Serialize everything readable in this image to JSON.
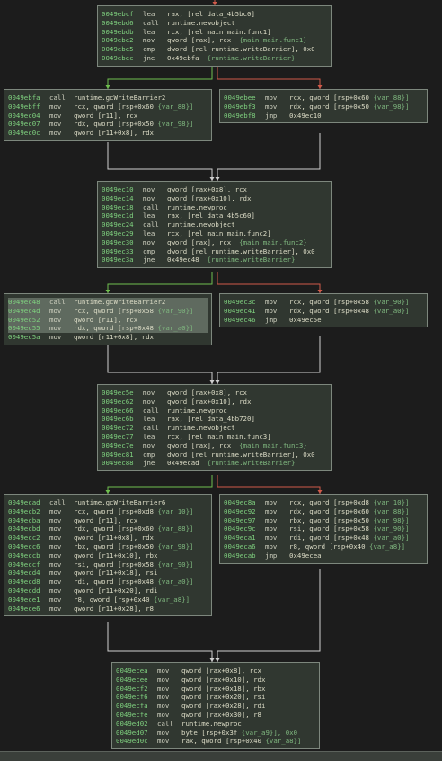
{
  "colors": {
    "background": "#1c1c1c",
    "block_fill": "#303730",
    "block_border": "#7d877d",
    "address": "#7fd17f",
    "mnemonic": "#cfd1c0",
    "operand": "#dcdcc6",
    "comment": "#7fb77f",
    "edge_unconditional": "#cfcfcf",
    "edge_true": "#6fbf4f",
    "edge_false": "#d05a4a",
    "highlight": "#5f6a5f"
  },
  "blocks": [
    {
      "id": "b0",
      "lines": [
        {
          "addr": "0049ebcf",
          "mn": "lea",
          "op": "rax, [rel data_4b5bc0]",
          "cm": ""
        },
        {
          "addr": "0049ebd6",
          "mn": "call",
          "op": "runtime.newobject",
          "cm": ""
        },
        {
          "addr": "0049ebdb",
          "mn": "lea",
          "op": "rcx, [rel main.main.func1]",
          "cm": ""
        },
        {
          "addr": "0049ebe2",
          "mn": "mov",
          "op": "qword [rax], rcx",
          "cm": "  {main.main.func1}"
        },
        {
          "addr": "0049ebe5",
          "mn": "cmp",
          "op": "dword [rel runtime.writeBarrier], 0x0",
          "cm": ""
        },
        {
          "addr": "0049ebec",
          "mn": "jne",
          "op": "0x49ebfa",
          "cm": "  {runtime.writeBarrier}"
        }
      ]
    },
    {
      "id": "b1",
      "lines": [
        {
          "addr": "0049ebfa",
          "mn": "call",
          "op": "runtime.gcWriteBarrier2",
          "cm": ""
        },
        {
          "addr": "0049ebff",
          "mn": "mov",
          "op": "rcx, qword [rsp+0x60 ",
          "cm": "{var_88}]"
        },
        {
          "addr": "0049ec04",
          "mn": "mov",
          "op": "qword [r11], rcx",
          "cm": ""
        },
        {
          "addr": "0049ec07",
          "mn": "mov",
          "op": "rdx, qword [rsp+0x50 ",
          "cm": "{var_98}]"
        },
        {
          "addr": "0049ec0c",
          "mn": "mov",
          "op": "qword [r11+0x8], rdx",
          "cm": ""
        }
      ]
    },
    {
      "id": "b2",
      "lines": [
        {
          "addr": "0049ebee",
          "mn": "mov",
          "op": "rcx, qword [rsp+0x60 ",
          "cm": "{var_88}]"
        },
        {
          "addr": "0049ebf3",
          "mn": "mov",
          "op": "rdx, qword [rsp+0x50 ",
          "cm": "{var_98}]"
        },
        {
          "addr": "0049ebf8",
          "mn": "jmp",
          "op": "0x49ec10",
          "cm": ""
        }
      ]
    },
    {
      "id": "b3",
      "lines": [
        {
          "addr": "0049ec10",
          "mn": "mov",
          "op": "qword [rax+0x8], rcx",
          "cm": ""
        },
        {
          "addr": "0049ec14",
          "mn": "mov",
          "op": "qword [rax+0x10], rdx",
          "cm": ""
        },
        {
          "addr": "0049ec18",
          "mn": "call",
          "op": "runtime.newproc",
          "cm": ""
        },
        {
          "addr": "0049ec1d",
          "mn": "lea",
          "op": "rax, [rel data_4b5c60]",
          "cm": ""
        },
        {
          "addr": "0049ec24",
          "mn": "call",
          "op": "runtime.newobject",
          "cm": ""
        },
        {
          "addr": "0049ec29",
          "mn": "lea",
          "op": "rcx, [rel main.main.func2]",
          "cm": ""
        },
        {
          "addr": "0049ec30",
          "mn": "mov",
          "op": "qword [rax], rcx",
          "cm": "  {main.main.func2}"
        },
        {
          "addr": "0049ec33",
          "mn": "cmp",
          "op": "dword [rel runtime.writeBarrier], 0x0",
          "cm": ""
        },
        {
          "addr": "0049ec3a",
          "mn": "jne",
          "op": "0x49ec48",
          "cm": "  {runtime.writeBarrier}"
        }
      ]
    },
    {
      "id": "b4",
      "lines": [
        {
          "addr": "0049ec48",
          "mn": "call",
          "op": "runtime.gcWriteBarrier2",
          "cm": "",
          "hl": true
        },
        {
          "addr": "0049ec4d",
          "mn": "mov",
          "op": "rcx, qword [rsp+0x58 ",
          "cm": "{var_90}]",
          "hl": true
        },
        {
          "addr": "0049ec52",
          "mn": "mov",
          "op": "qword [r11], rcx",
          "cm": "",
          "hl": true
        },
        {
          "addr": "0049ec55",
          "mn": "mov",
          "op": "rdx, qword [rsp+0x48 ",
          "cm": "{var_a0}]",
          "hl": true
        },
        {
          "addr": "0049ec5a",
          "mn": "mov",
          "op": "qword [r11+0x8], rdx",
          "cm": ""
        }
      ]
    },
    {
      "id": "b5",
      "lines": [
        {
          "addr": "0049ec3c",
          "mn": "mov",
          "op": "rcx, qword [rsp+0x58 ",
          "cm": "{var_90}]"
        },
        {
          "addr": "0049ec41",
          "mn": "mov",
          "op": "rdx, qword [rsp+0x48 ",
          "cm": "{var_a0}]"
        },
        {
          "addr": "0049ec46",
          "mn": "jmp",
          "op": "0x49ec5e",
          "cm": ""
        }
      ]
    },
    {
      "id": "b6",
      "lines": [
        {
          "addr": "0049ec5e",
          "mn": "mov",
          "op": "qword [rax+0x8], rcx",
          "cm": ""
        },
        {
          "addr": "0049ec62",
          "mn": "mov",
          "op": "qword [rax+0x10], rdx",
          "cm": ""
        },
        {
          "addr": "0049ec66",
          "mn": "call",
          "op": "runtime.newproc",
          "cm": ""
        },
        {
          "addr": "0049ec6b",
          "mn": "lea",
          "op": "rax, [rel data_4bb720]",
          "cm": ""
        },
        {
          "addr": "0049ec72",
          "mn": "call",
          "op": "runtime.newobject",
          "cm": ""
        },
        {
          "addr": "0049ec77",
          "mn": "lea",
          "op": "rcx, [rel main.main.func3]",
          "cm": ""
        },
        {
          "addr": "0049ec7e",
          "mn": "mov",
          "op": "qword [rax], rcx",
          "cm": "  {main.main.func3}"
        },
        {
          "addr": "0049ec81",
          "mn": "cmp",
          "op": "dword [rel runtime.writeBarrier], 0x0",
          "cm": ""
        },
        {
          "addr": "0049ec88",
          "mn": "jne",
          "op": "0x49ecad",
          "cm": "  {runtime.writeBarrier}"
        }
      ]
    },
    {
      "id": "b7",
      "lines": [
        {
          "addr": "0049ecad",
          "mn": "call",
          "op": "runtime.gcWriteBarrier6",
          "cm": ""
        },
        {
          "addr": "0049ecb2",
          "mn": "mov",
          "op": "rcx, qword [rsp+0xd8 ",
          "cm": "{var_10}]"
        },
        {
          "addr": "0049ecba",
          "mn": "mov",
          "op": "qword [r11], rcx",
          "cm": ""
        },
        {
          "addr": "0049ecbd",
          "mn": "mov",
          "op": "rdx, qword [rsp+0x60 ",
          "cm": "{var_88}]"
        },
        {
          "addr": "0049ecc2",
          "mn": "mov",
          "op": "qword [r11+0x8], rdx",
          "cm": ""
        },
        {
          "addr": "0049ecc6",
          "mn": "mov",
          "op": "rbx, qword [rsp+0x50 ",
          "cm": "{var_98}]"
        },
        {
          "addr": "0049eccb",
          "mn": "mov",
          "op": "qword [r11+0x10], rbx",
          "cm": ""
        },
        {
          "addr": "0049eccf",
          "mn": "mov",
          "op": "rsi, qword [rsp+0x58 ",
          "cm": "{var_90}]"
        },
        {
          "addr": "0049ecd4",
          "mn": "mov",
          "op": "qword [r11+0x18], rsi",
          "cm": ""
        },
        {
          "addr": "0049ecd8",
          "mn": "mov",
          "op": "rdi, qword [rsp+0x48 ",
          "cm": "{var_a0}]"
        },
        {
          "addr": "0049ecdd",
          "mn": "mov",
          "op": "qword [r11+0x20], rdi",
          "cm": ""
        },
        {
          "addr": "0049ece1",
          "mn": "mov",
          "op": "r8, qword [rsp+0x40 ",
          "cm": "{var_a8}]"
        },
        {
          "addr": "0049ece6",
          "mn": "mov",
          "op": "qword [r11+0x28], r8",
          "cm": ""
        }
      ]
    },
    {
      "id": "b8",
      "lines": [
        {
          "addr": "0049ec8a",
          "mn": "mov",
          "op": "rcx, qword [rsp+0xd8 ",
          "cm": "{var_10}]"
        },
        {
          "addr": "0049ec92",
          "mn": "mov",
          "op": "rdx, qword [rsp+0x60 ",
          "cm": "{var_88}]"
        },
        {
          "addr": "0049ec97",
          "mn": "mov",
          "op": "rbx, qword [rsp+0x50 ",
          "cm": "{var_98}]"
        },
        {
          "addr": "0049ec9c",
          "mn": "mov",
          "op": "rsi, qword [rsp+0x58 ",
          "cm": "{var_90}]"
        },
        {
          "addr": "0049eca1",
          "mn": "mov",
          "op": "rdi, qword [rsp+0x48 ",
          "cm": "{var_a0}]"
        },
        {
          "addr": "0049eca6",
          "mn": "mov",
          "op": "r8, qword [rsp+0x40 ",
          "cm": "{var_a8}]"
        },
        {
          "addr": "0049ecab",
          "mn": "jmp",
          "op": "0x49ecea",
          "cm": ""
        }
      ]
    },
    {
      "id": "b9",
      "lines": [
        {
          "addr": "0049ecea",
          "mn": "mov",
          "op": "qword [rax+0x8], rcx",
          "cm": ""
        },
        {
          "addr": "0049ecee",
          "mn": "mov",
          "op": "qword [rax+0x10], rdx",
          "cm": ""
        },
        {
          "addr": "0049ecf2",
          "mn": "mov",
          "op": "qword [rax+0x18], rbx",
          "cm": ""
        },
        {
          "addr": "0049ecf6",
          "mn": "mov",
          "op": "qword [rax+0x20], rsi",
          "cm": ""
        },
        {
          "addr": "0049ecfa",
          "mn": "mov",
          "op": "qword [rax+0x28], rdi",
          "cm": ""
        },
        {
          "addr": "0049ecfe",
          "mn": "mov",
          "op": "qword [rax+0x30], r8",
          "cm": ""
        },
        {
          "addr": "0049ed02",
          "mn": "call",
          "op": "runtime.newproc",
          "cm": ""
        },
        {
          "addr": "0049ed07",
          "mn": "mov",
          "op": "byte [rsp+0x3f ",
          "cm": "{var_a9}], 0x0"
        },
        {
          "addr": "0049ed0c",
          "mn": "mov",
          "op": "rax, qword [rsp+0x40 ",
          "cm": "{var_a8}]"
        }
      ]
    }
  ]
}
